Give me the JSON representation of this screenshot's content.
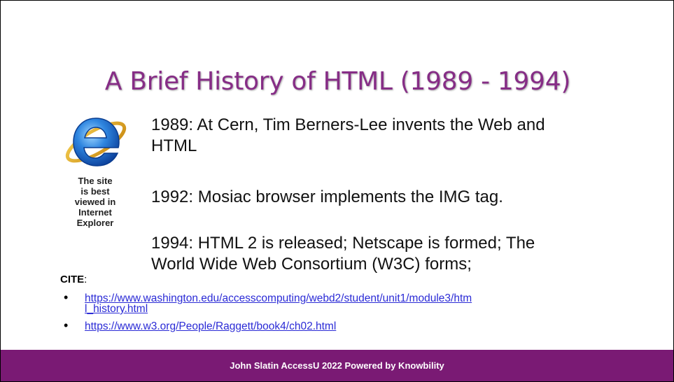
{
  "title": "A Brief History of HTML (1989 - 1994)",
  "logo": {
    "icon": "internet-explorer-logo",
    "caption_lines": [
      "The site",
      "is best",
      "viewed in",
      "Internet",
      "Explorer"
    ]
  },
  "items": [
    {
      "text_line1": "1989: At Cern, Tim Berners-Lee invents the Web and",
      "text_line2": "HTML"
    },
    {
      "text_line1": "1992: Mosiac browser implements the IMG tag."
    },
    {
      "text_line1": "1994: HTML 2 is released; Netscape is formed; The",
      "text_line2": "World Wide Web Consortium (W3C) forms;"
    }
  ],
  "cite": {
    "label": "CITE",
    "colon": ":",
    "links": [
      {
        "line1": "https://www.washington.edu/accesscomputing/webd2/student/unit1/module3/htm",
        "line2": "l_history.html"
      },
      {
        "line1": "https://www.w3.org/People/Raggett/book4/ch02.html"
      }
    ]
  },
  "footer": "John Slatin AccessU 2022 Powered by Knowbility",
  "colors": {
    "title": "#862d86",
    "footer_bg": "#7a1a74",
    "link": "#2b2bd6"
  }
}
